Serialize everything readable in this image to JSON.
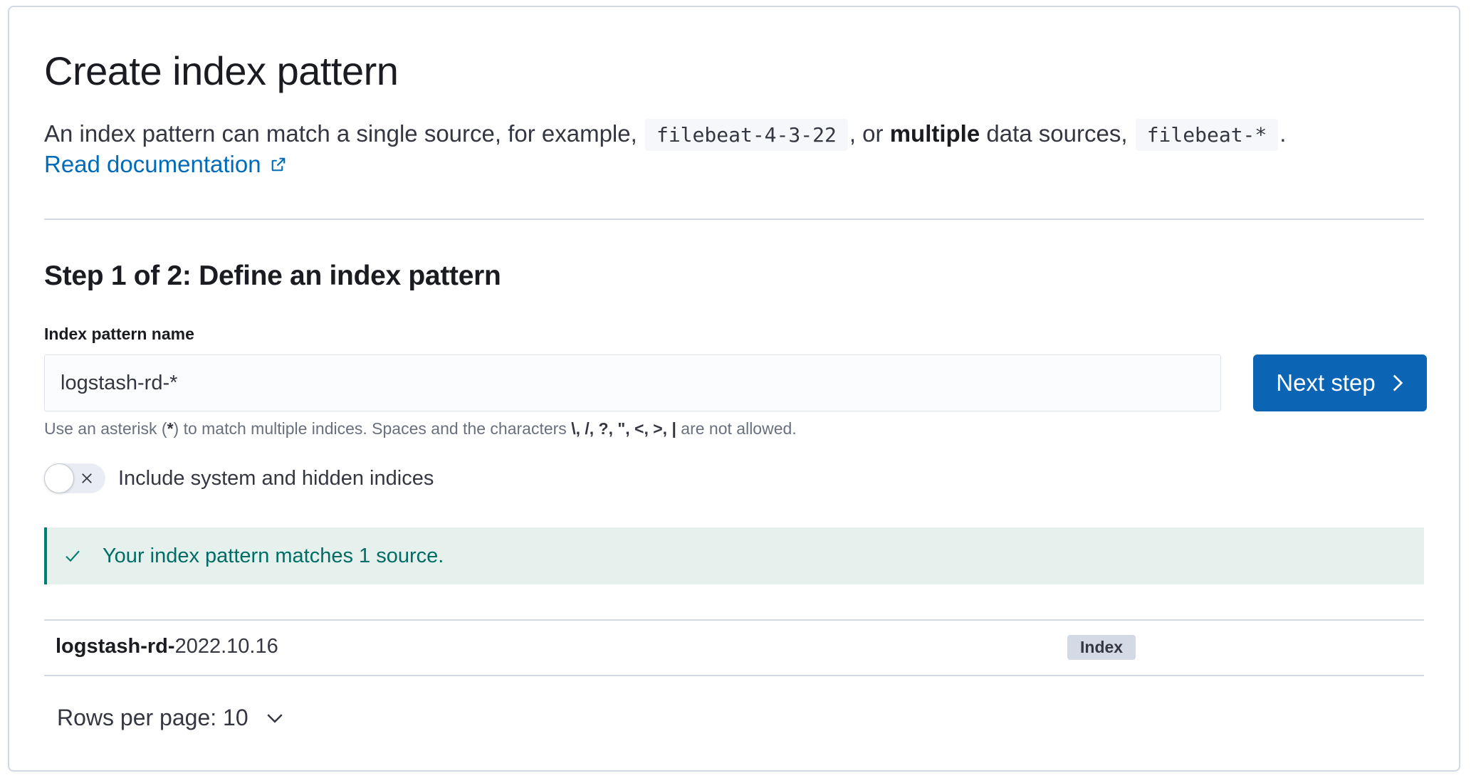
{
  "header": {
    "title": "Create index pattern",
    "description_prefix": "An index pattern can match a single source, for example,",
    "example_single": "filebeat-4-3-22",
    "description_middle_pre": ", or",
    "description_bold": "multiple",
    "description_middle_post": "data sources,",
    "example_multiple": "filebeat-*",
    "description_suffix": ".",
    "doc_link": "Read documentation",
    "doc_link_icon": "external-link-icon"
  },
  "step": {
    "title": "Step 1 of 2: Define an index pattern",
    "field_label": "Index pattern name",
    "input_value": "logstash-rd-*",
    "next_button": "Next step",
    "next_button_icon": "chevron-right-icon",
    "help_prefix": "Use an asterisk (",
    "help_asterisk": "*",
    "help_middle": ") to match multiple indices. Spaces and the characters",
    "help_chars": "\\, /, ?, \", <, >, |",
    "help_suffix": "are not allowed.",
    "toggle_label": "Include system and hidden indices",
    "toggle_on": false
  },
  "callout": {
    "icon": "check-icon",
    "text": "Your index pattern matches 1 source."
  },
  "table": {
    "rows": [
      {
        "name_match": "logstash-rd-",
        "name_rest": "2022.10.16",
        "type": "Index"
      }
    ]
  },
  "pagination": {
    "rows_per_page": "Rows per page: 10",
    "icon": "chevron-down-icon"
  },
  "colors": {
    "primary": "#0b64b4",
    "link": "#006bb8",
    "success_bg": "#e6f1ee",
    "success_text": "#016d64",
    "border": "#d3dae6"
  }
}
